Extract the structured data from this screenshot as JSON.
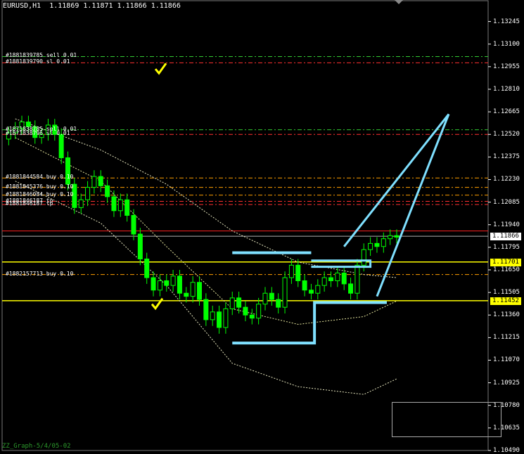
{
  "header": "EURUSD,H1  1.11869 1.11871 1.11866 1.11866",
  "indicator_label": "ZZ_Graph-5/4/05-02",
  "order_labels": [
    {
      "text": "#1881839785 sell 0.01",
      "price": 1.1302
    },
    {
      "text": "#1881839790 sl 0.01",
      "price": 1.1298
    },
    {
      "text": "#1871838785 sell 0.01",
      "price": 1.1255
    },
    {
      "text": "#1871838796 sl 0.01",
      "price": 1.1252
    },
    {
      "text": "#1881844584 buy 0.10",
      "price": 1.1224
    },
    {
      "text": "#1881845376 buy 0.10",
      "price": 1.1218
    },
    {
      "text": "#1881846084 buy 0.10",
      "price": 1.1213
    },
    {
      "text": "#1881846187 tp",
      "price": 1.1209
    },
    {
      "text": "#1881846187 tp",
      "price": 1.1207
    },
    {
      "text": "#1882157713 buy 0.10",
      "price": 1.1162
    }
  ],
  "price_tags": [
    {
      "text": "1.11866",
      "price": 1.11866,
      "style": "w"
    },
    {
      "text": "1.11701",
      "price": 1.11701,
      "style": "y"
    },
    {
      "text": "1.11452",
      "price": 1.11452,
      "style": "y"
    }
  ],
  "colors": {
    "candle": "#00ff00",
    "sell_line": "#ff3030",
    "buy_line": "#ffa000",
    "level_line": "#ffff00",
    "annotation": "#7fe0ff",
    "bid_line": "#b0b0b0",
    "red_line": "#ff2020"
  },
  "chart_data": {
    "type": "candlestick",
    "symbol": "EURUSD",
    "timeframe": "H1",
    "title": "EURUSD,H1  1.11869 1.11871 1.11866 1.11866",
    "ylim": [
      1.1049,
      1.1332
    ],
    "y_ticks": [
      "1.13245",
      "1.13100",
      "1.12955",
      "1.12810",
      "1.12665",
      "1.12520",
      "1.12375",
      "1.12230",
      "1.12085",
      "1.11940",
      "1.11795",
      "1.11650",
      "1.11505",
      "1.11360",
      "1.11215",
      "1.11070",
      "1.10925",
      "1.10780",
      "1.10635",
      "1.10490"
    ],
    "last_price": 1.11866,
    "horizontal_levels": [
      {
        "price": 1.11701,
        "color": "yellow"
      },
      {
        "price": 1.11452,
        "color": "yellow"
      },
      {
        "price": 1.119,
        "color": "red"
      }
    ],
    "close_path": [
      [
        0,
        1.1249
      ],
      [
        2,
        1.1253
      ],
      [
        4,
        1.1256
      ],
      [
        6,
        1.126
      ],
      [
        8,
        1.1257
      ],
      [
        10,
        1.125
      ],
      [
        12,
        1.1252
      ],
      [
        14,
        1.1258
      ],
      [
        16,
        1.1252
      ],
      [
        18,
        1.1237
      ],
      [
        20,
        1.122
      ],
      [
        22,
        1.1205
      ],
      [
        24,
        1.121
      ],
      [
        26,
        1.1218
      ],
      [
        28,
        1.1225
      ],
      [
        30,
        1.1219
      ],
      [
        32,
        1.1212
      ],
      [
        34,
        1.1203
      ],
      [
        36,
        1.121
      ],
      [
        38,
        1.12
      ],
      [
        40,
        1.1188
      ],
      [
        42,
        1.1172
      ],
      [
        44,
        1.116
      ],
      [
        46,
        1.1152
      ],
      [
        48,
        1.1158
      ],
      [
        50,
        1.1155
      ],
      [
        52,
        1.1161
      ],
      [
        54,
        1.115
      ],
      [
        56,
        1.1148
      ],
      [
        58,
        1.1157
      ],
      [
        60,
        1.1146
      ],
      [
        62,
        1.1133
      ],
      [
        64,
        1.1138
      ],
      [
        66,
        1.1128
      ],
      [
        68,
        1.114
      ],
      [
        70,
        1.1147
      ],
      [
        72,
        1.1141
      ],
      [
        74,
        1.1136
      ],
      [
        76,
        1.1134
      ],
      [
        78,
        1.1143
      ],
      [
        80,
        1.115
      ],
      [
        82,
        1.1146
      ],
      [
        84,
        1.1141
      ],
      [
        86,
        1.116
      ],
      [
        88,
        1.1168
      ],
      [
        90,
        1.1158
      ],
      [
        92,
        1.1152
      ],
      [
        94,
        1.115
      ],
      [
        96,
        1.1155
      ],
      [
        98,
        1.116
      ],
      [
        100,
        1.1158
      ],
      [
        102,
        1.1163
      ],
      [
        104,
        1.1156
      ],
      [
        106,
        1.115
      ],
      [
        108,
        1.1168
      ],
      [
        110,
        1.1178
      ],
      [
        112,
        1.1182
      ],
      [
        114,
        1.118
      ],
      [
        116,
        1.1185
      ],
      [
        118,
        1.1187
      ],
      [
        120,
        1.1186
      ]
    ],
    "envelope_upper": [
      [
        4,
        1.1262
      ],
      [
        30,
        1.1242
      ],
      [
        50,
        1.122
      ],
      [
        70,
        1.119
      ],
      [
        90,
        1.117
      ],
      [
        110,
        1.1162
      ],
      [
        120,
        1.116
      ]
    ],
    "envelope_mid": [
      [
        4,
        1.125
      ],
      [
        30,
        1.1222
      ],
      [
        50,
        1.118
      ],
      [
        70,
        1.114
      ],
      [
        90,
        1.113
      ],
      [
        110,
        1.1135
      ],
      [
        120,
        1.1145
      ]
    ],
    "envelope_lower": [
      [
        4,
        1.1222
      ],
      [
        30,
        1.1195
      ],
      [
        50,
        1.1155
      ],
      [
        70,
        1.1105
      ],
      [
        90,
        1.109
      ],
      [
        110,
        1.1085
      ],
      [
        120,
        1.1095
      ]
    ]
  }
}
